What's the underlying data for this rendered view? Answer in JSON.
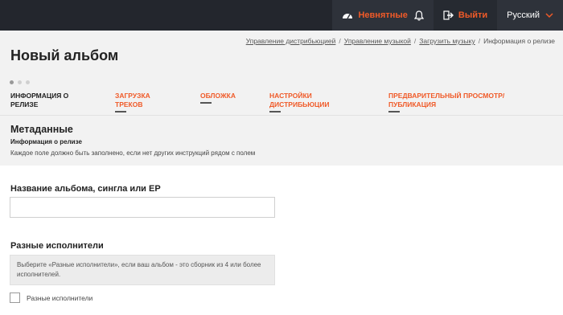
{
  "topbar": {
    "unread_label": "Невнятные",
    "logout_label": "Выйти",
    "language_label": "Русский",
    "accent_color": "#f05a28"
  },
  "breadcrumb": {
    "items": [
      "Управление дистрибьюцией",
      "Управление музыкой",
      "Загрузить музыку"
    ],
    "current": "Информация о релизе",
    "separator": "/"
  },
  "page": {
    "title": "Новый альбом"
  },
  "steps": [
    {
      "label": "ИНФОРМАЦИЯ О РЕЛИЗЕ",
      "active": true
    },
    {
      "label": "ЗАГРУЗКА ТРЕКОВ",
      "active": false
    },
    {
      "label": "ОБЛОЖКА",
      "active": false
    },
    {
      "label": "НАСТРОЙКИ ДИСТРИБЬЮЦИИ",
      "active": false
    },
    {
      "label": "ПРЕДВАРИТЕЛЬНЫЙ ПРОСМОТР/ ПУБЛИКАЦИЯ",
      "active": false
    }
  ],
  "metadata": {
    "title": "Метаданные",
    "subtitle": "Информация о релизе",
    "note": "Каждое поле должно быть заполнено, если нет других инструкций рядом с полем"
  },
  "form": {
    "album_name_label": "Название альбома, сингла или EP",
    "album_name_value": "",
    "various_artists_label": "Разные исполнители",
    "various_artists_hint": "Выберите «Разные исполнители», если ваш альбом - это сборник из 4 или более исполнителей.",
    "various_artists_checkbox_label": "Разные исполнители"
  }
}
